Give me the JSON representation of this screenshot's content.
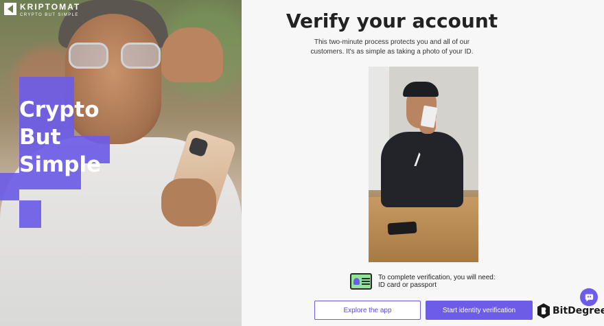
{
  "brand": {
    "name": "KRIPTOMAT",
    "tagline": "CRYPTO BUT SIMPLE",
    "accent_color": "#6c5ce7"
  },
  "hero": {
    "slogan_lines": [
      "Crypto",
      "But",
      "Simple"
    ]
  },
  "main": {
    "title": "Verify your account",
    "subtitle": "This two-minute process protects you and all of our customers. It's as simple as taking a photo of your ID.",
    "requirement_line1": "To complete verification, you will need:",
    "requirement_line2": "ID card or passport",
    "requirement_icon": "id-card-icon"
  },
  "actions": {
    "explore_label": "Explore the app",
    "start_label": "Start identity verification"
  },
  "widgets": {
    "help_icon": "chat-help-icon",
    "watermark": "BitDegree"
  }
}
